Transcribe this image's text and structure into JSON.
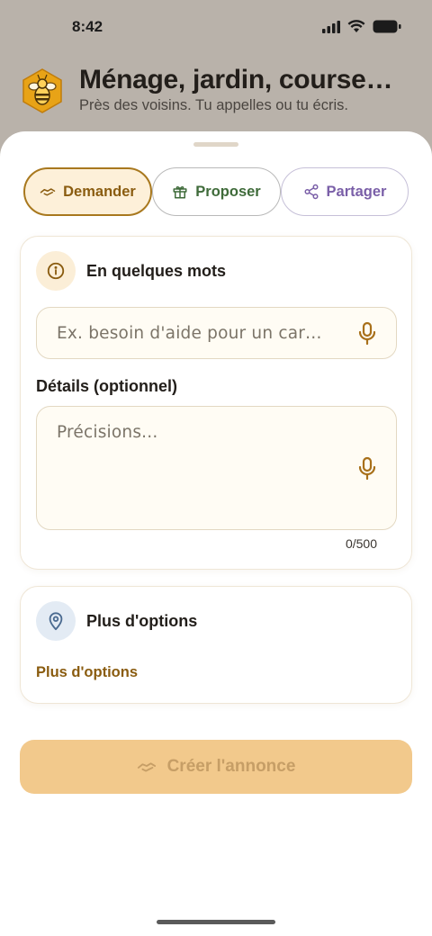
{
  "status_bar": {
    "time": "8:42"
  },
  "header": {
    "title": "Ménage, jardin, course…",
    "subtitle": "Près des voisins. Tu appelles ou tu écris."
  },
  "tabs": [
    {
      "label": "Demander",
      "icon": "handshake-icon",
      "selected": true
    },
    {
      "label": "Proposer",
      "icon": "gift-icon",
      "selected": false
    },
    {
      "label": "Partager",
      "icon": "share-icon",
      "selected": false
    }
  ],
  "summary_card": {
    "title": "En quelques mots",
    "icon": "info-icon",
    "input_placeholder": "Ex. besoin d'aide pour un car…",
    "details_label": "Détails (optionnel)",
    "details_placeholder": "Précisions...",
    "counter": "0/500"
  },
  "options_card": {
    "title": "Plus d'options",
    "icon": "location-pin-icon",
    "link": "Plus d'options"
  },
  "create_button": {
    "label": "Créer l'annonce",
    "enabled": false
  },
  "colors": {
    "accent": "#a8781e",
    "accent_bg": "#fdf0d9",
    "proposer": "#3f6b3a",
    "partager": "#7a5fa8",
    "button_disabled": "#f2c98c"
  }
}
